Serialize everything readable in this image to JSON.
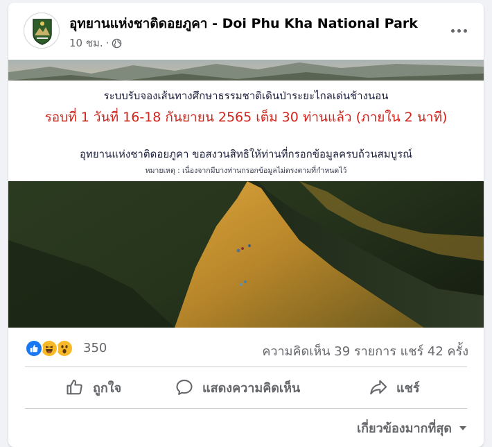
{
  "post": {
    "page_name": "อุทยานแห่งชาติดอยภูคา - Doi Phu Kha National Park",
    "time": "10 ชม.",
    "separator": "·",
    "privacy_icon": "globe-icon",
    "more_icon": "ellipsis-icon"
  },
  "image": {
    "banner_line1": "ระบบรับจองเส้นทางศึกษาธรรมชาติเดินป่าระยะไกลเด่นช้างนอน",
    "banner_line2": "รอบที่ 1 วันที่ 16-18 กันยายน 2565 เต็ม 30 ท่านแล้ว (ภายใน 2 นาที)",
    "banner_line3": "อุทยานแห่งชาติดอยภูคา ขอสงวนสิทธิให้ท่านที่กรอกข้อมูลครบถ้วนสมบูรณ์",
    "banner_line4": "หมายเหตุ : เนื่องจากมีบางท่านกรอกข้อมูลไม่ตรงตามที่กำหนดไว้",
    "highlight_color": "#d0231c"
  },
  "stats": {
    "reaction_icons": [
      "like-icon",
      "haha-icon",
      "wow-icon"
    ],
    "reaction_count": "350",
    "comments": "ความคิดเห็น 39 รายการ",
    "shares": "แชร์ 42 ครั้ง"
  },
  "actions": {
    "like": "ถูกใจ",
    "comment": "แสดงความคิดเห็น",
    "share": "แชร์"
  },
  "comments_sort": {
    "label": "เกี่ยวข้องมากที่สุด"
  },
  "colors": {
    "like_blue": "#1877f2",
    "reaction_yellow": "#f7b928",
    "secondary_text": "#65676b"
  }
}
